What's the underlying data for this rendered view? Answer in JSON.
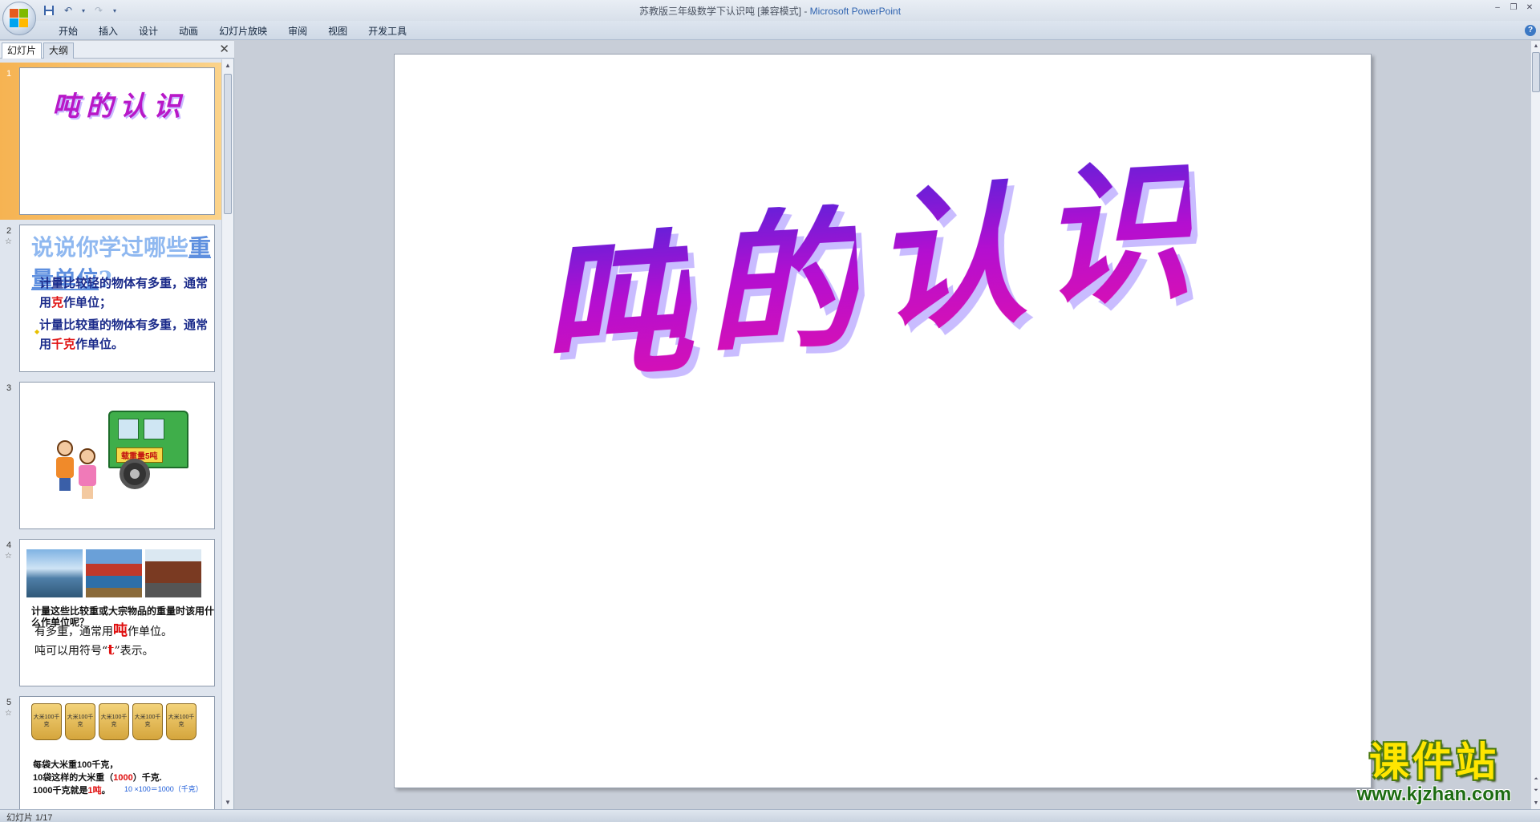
{
  "window": {
    "title_doc": "苏教版三年级数学下认识吨 [兼容模式]",
    "title_sep": " - ",
    "title_app": "Microsoft PowerPoint",
    "controls": [
      "–",
      "❐",
      "✕"
    ]
  },
  "ribbon": {
    "tabs": [
      "开始",
      "插入",
      "设计",
      "动画",
      "幻灯片放映",
      "审阅",
      "视图",
      "开发工具"
    ],
    "help": "?"
  },
  "panel": {
    "tabs": [
      "幻灯片",
      "大纲"
    ],
    "close": "✕"
  },
  "thumbnails": [
    {
      "num": "1",
      "title": "吨的认识"
    },
    {
      "num": "2",
      "heading_a": "说说你学过哪些",
      "heading_b": "重量单位",
      "heading_c": "?",
      "line1_a": "计量比较轻的物体有多重，通常用",
      "line1_red": "克",
      "line1_b": "作单位；",
      "line2_a": "计量比较重的物体有多重，通常用",
      "line2_red": "千克",
      "line2_b": "作单位。"
    },
    {
      "num": "3",
      "badge": "载重量5吨"
    },
    {
      "num": "4",
      "overlap": "计量这些比较重或大宗物品的重量时该用什么作单位呢？",
      "line1_a": "有多重，通常用",
      "line1_red": "吨",
      "line1_b": "作单位。",
      "line2_a": "吨可以用符号“",
      "line2_red": "t",
      "line2_b": "”表示。"
    },
    {
      "num": "5",
      "bag_label": "大米100千克",
      "line1": "每袋大米重100千克，",
      "line2_a": "10袋这样的大米重（",
      "line2_red": "1000",
      "line2_b": "）千克.",
      "line3_a": "1000千克就是",
      "line3_red": "1吨",
      "line3_b": "。",
      "formula": "10 ×100＝1000（千克）"
    }
  ],
  "slide": {
    "title_chars": [
      "吨",
      "的",
      "认",
      "识"
    ]
  },
  "watermark": {
    "main": "课件站",
    "url": "www.kjzhan.com"
  },
  "status": {
    "slide_info": "幻灯片 1/17"
  }
}
